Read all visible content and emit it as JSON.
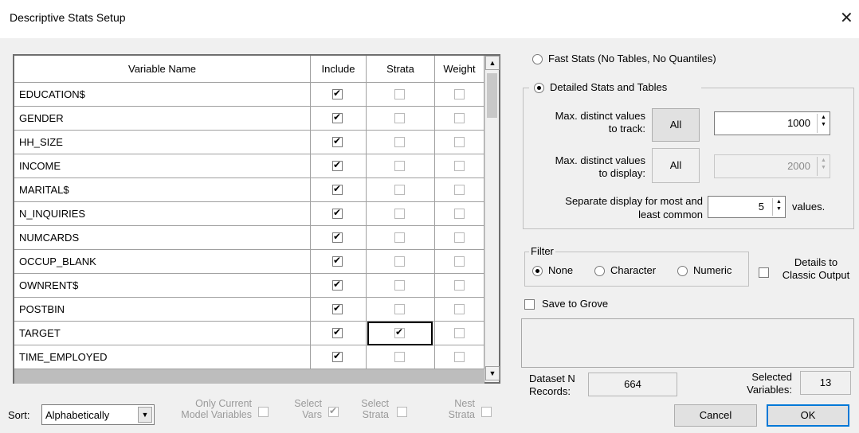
{
  "window": {
    "title": "Descriptive Stats Setup",
    "close_glyph": "✕"
  },
  "grid": {
    "columns": [
      "Variable Name",
      "Include",
      "Strata",
      "Weight"
    ],
    "rows": [
      {
        "name": "EDUCATION$",
        "include": true,
        "strata": false,
        "weight": false
      },
      {
        "name": "GENDER",
        "include": true,
        "strata": false,
        "weight": false
      },
      {
        "name": "HH_SIZE",
        "include": true,
        "strata": false,
        "weight": false
      },
      {
        "name": "INCOME",
        "include": true,
        "strata": false,
        "weight": false
      },
      {
        "name": "MARITAL$",
        "include": true,
        "strata": false,
        "weight": false
      },
      {
        "name": "N_INQUIRIES",
        "include": true,
        "strata": false,
        "weight": false
      },
      {
        "name": "NUMCARDS",
        "include": true,
        "strata": false,
        "weight": false
      },
      {
        "name": "OCCUP_BLANK",
        "include": true,
        "strata": false,
        "weight": false
      },
      {
        "name": "OWNRENT$",
        "include": true,
        "strata": false,
        "weight": false
      },
      {
        "name": "POSTBIN",
        "include": true,
        "strata": false,
        "weight": false
      },
      {
        "name": "TARGET",
        "include": true,
        "strata": true,
        "weight": false
      },
      {
        "name": "TIME_EMPLOYED",
        "include": true,
        "strata": false,
        "weight": false
      }
    ]
  },
  "bottom": {
    "sort_label": "Sort:",
    "sort_value": "Alphabetically",
    "only_current_line1": "Only Current",
    "only_current_line2": "Model Variables",
    "select_vars_line1": "Select",
    "select_vars_line2": "Vars",
    "select_strata_line1": "Select",
    "select_strata_line2": "Strata",
    "nest_strata_line1": "Nest",
    "nest_strata_line2": "Strata"
  },
  "options": {
    "fast_stats": "Fast Stats (No Tables, No Quantiles)",
    "detailed_stats": "Detailed Stats and Tables",
    "max_track_line1": "Max. distinct values",
    "max_track_line2": "to track:",
    "max_track_btn": "All",
    "max_track_value": "1000",
    "max_display_line1": "Max. distinct values",
    "max_display_line2": "to display:",
    "max_display_btn": "All",
    "max_display_value": "2000",
    "separate_line1": "Separate display for most and",
    "separate_line2": "least common",
    "separate_value": "5",
    "values_label": "values."
  },
  "filter": {
    "label": "Filter",
    "none": "None",
    "character": "Character",
    "numeric": "Numeric",
    "details_line1": "Details to",
    "details_line2": "Classic Output"
  },
  "save_grove": "Save to Grove",
  "dataset": {
    "label_line1": "Dataset N",
    "label_line2": "Records:",
    "value": "664"
  },
  "selected": {
    "label_line1": "Selected",
    "label_line2": "Variables:",
    "value": "13"
  },
  "buttons": {
    "cancel": "Cancel",
    "ok": "OK"
  }
}
